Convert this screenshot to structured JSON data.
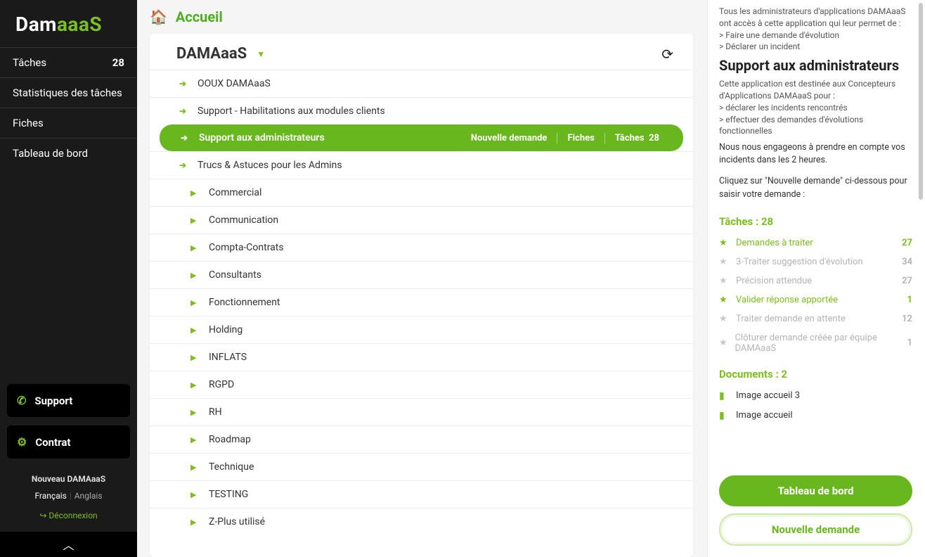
{
  "brand": {
    "prefix": "Dam",
    "suffix": "aaaS"
  },
  "sidebar": {
    "items": [
      {
        "label": "Tâches",
        "count": "28"
      },
      {
        "label": "Statistiques des tâches"
      },
      {
        "label": "Fiches"
      },
      {
        "label": "Tableau de bord"
      }
    ],
    "support_label": "Support",
    "contrat_label": "Contrat",
    "brand_small": "Nouveau DAMAaaS",
    "lang_fr": "Français",
    "لang_en": "Anglais",
    "logout": "Déconnexion"
  },
  "breadcrumb": {
    "title": "Accueil"
  },
  "panel": {
    "title": "DAMAaaS",
    "rows": [
      {
        "type": "link",
        "label": "OOUX DAMAaaS"
      },
      {
        "type": "link",
        "label": "Support - Habilitations aux modules clients"
      },
      {
        "type": "selected",
        "label": "Support aux administrateurs",
        "actions": {
          "new": "Nouvelle demande",
          "fiches": "Fiches",
          "taches": "Tâches",
          "count": "28"
        }
      },
      {
        "type": "link",
        "label": "Trucs & Astuces pour les Admins"
      },
      {
        "type": "folder",
        "label": "Commercial"
      },
      {
        "type": "folder",
        "label": "Communication"
      },
      {
        "type": "folder",
        "label": "Compta-Contrats"
      },
      {
        "type": "folder",
        "label": "Consultants"
      },
      {
        "type": "folder",
        "label": "Fonctionnement"
      },
      {
        "type": "folder",
        "label": "Holding"
      },
      {
        "type": "folder",
        "label": "INFLATS"
      },
      {
        "type": "folder",
        "label": "RGPD"
      },
      {
        "type": "folder",
        "label": "RH"
      },
      {
        "type": "folder",
        "label": "Roadmap"
      },
      {
        "type": "folder",
        "label": "Technique"
      },
      {
        "type": "folder",
        "label": "TESTING"
      },
      {
        "type": "folder",
        "label": "Z-Plus utilisé"
      }
    ]
  },
  "right": {
    "intro1": "Tous les administrateurs d'applications DAMAaaS ont accès à cette application qui leur permet de :",
    "intro2": "> Faire une demande d'évolution",
    "intro3": "> Déclarer un incident",
    "title": "Support aux administrateurs",
    "desc1": "Cette application est destinée aux Concepteurs d'Applications DAMAaaS pour :",
    "desc2": "> déclarer les incidents rencontrés",
    "desc3": "> effectuer des demandes d'évolutions fonctionnelles",
    "engage": "Nous nous engageons à prendre en compte vos incidents dans les 2 heures.",
    "click": "Cliquez sur \"Nouvelle demande\" ci-dessous pour saisir votre demande :",
    "tasks_title": "Tâches : 28",
    "tasks": [
      {
        "label": "Demandes à traiter",
        "count": "27",
        "active": true
      },
      {
        "label": "3-Traiter suggestion d'évolution",
        "count": "34",
        "active": false
      },
      {
        "label": "Précision attendue",
        "count": "27",
        "active": false
      },
      {
        "label": "Valider réponse apportée",
        "count": "1",
        "active": true
      },
      {
        "label": "Traiter demande en attente",
        "count": "12",
        "active": false
      },
      {
        "label": "Clôturer demande créée par équipe DAMAaaS",
        "count": "1",
        "active": false
      }
    ],
    "docs_title": "Documents : 2",
    "docs": [
      {
        "label": "Image accueil 3"
      },
      {
        "label": "Image accueil"
      }
    ],
    "btn_dashboard": "Tableau de bord",
    "btn_new": "Nouvelle demande"
  }
}
